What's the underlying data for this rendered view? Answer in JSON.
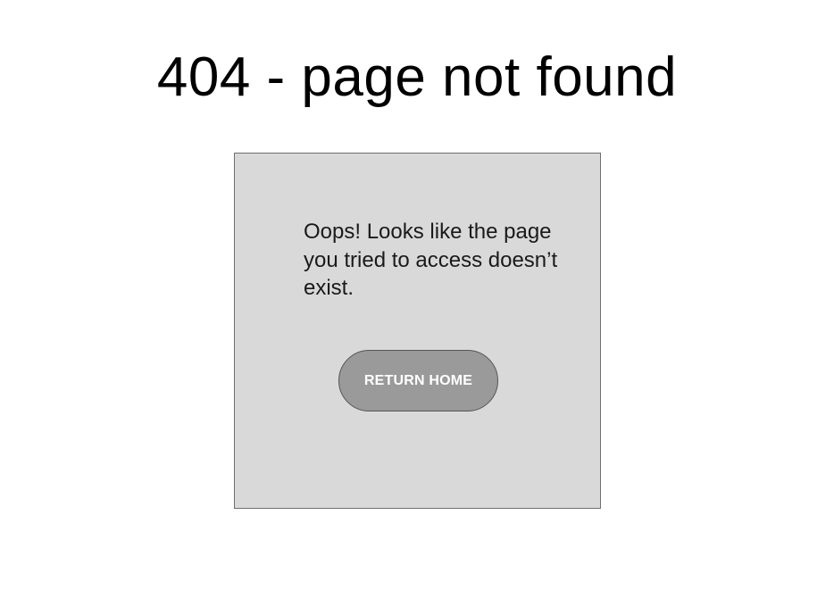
{
  "page": {
    "title": "404 - page not found"
  },
  "card": {
    "message": "Oops! Looks like the page you tried to access doesn’t exist.",
    "return_home_label": "RETURN HOME"
  },
  "colors": {
    "background": "#ffffff",
    "card_fill": "#d9d9d9",
    "card_border": "#6f6f6f",
    "button_fill": "#9a9a9a",
    "button_text": "#ffffff"
  }
}
